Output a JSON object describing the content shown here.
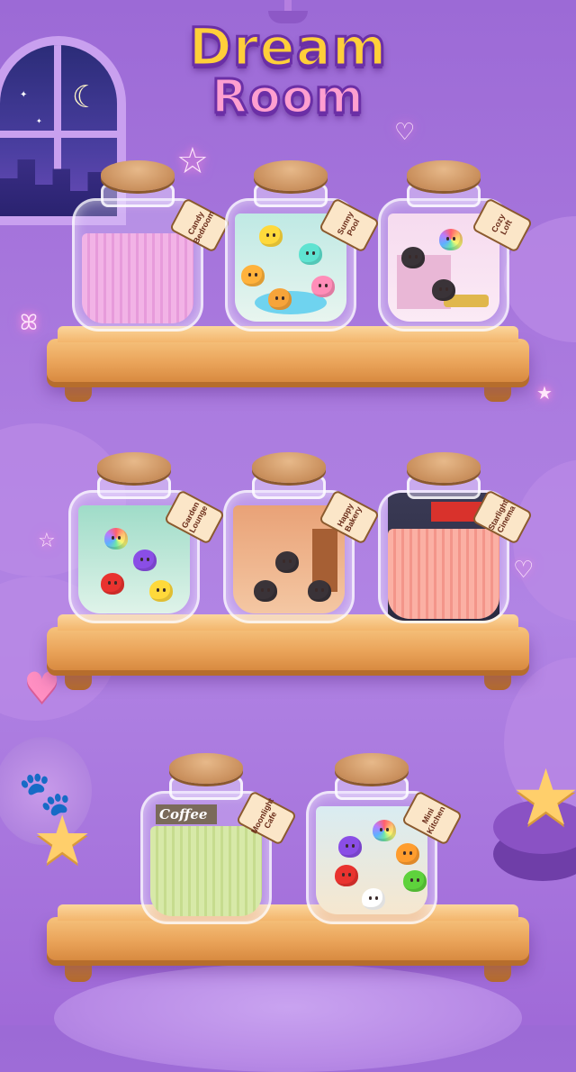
{
  "title": {
    "line1": "Dream",
    "line2": "Room"
  },
  "jars": [
    {
      "id": "candy-bedroom",
      "label": "Candy Bedroom",
      "style": "locked-pink"
    },
    {
      "id": "sunny-pool",
      "label": "Sunny Pool",
      "style": "room-teal"
    },
    {
      "id": "cozy-loft",
      "label": "Cozy Loft",
      "style": "room-pink"
    },
    {
      "id": "garden-lounge",
      "label": "Garden Lounge",
      "style": "room-mint"
    },
    {
      "id": "happy-bakery",
      "label": "Happy Bakery",
      "style": "room-brown"
    },
    {
      "id": "starlight-cinema",
      "label": "Starlight Cinema",
      "style": "locked-salmon"
    },
    {
      "id": "moonlight-cafe",
      "label": "Moonlight Cafe",
      "sign": "Coffee",
      "style": "locked-green"
    },
    {
      "id": "mini-kitchen",
      "label": "Mini Kitchen",
      "style": "room-beige"
    }
  ],
  "icons": [
    "moon-icon",
    "star-icon",
    "heart-icon",
    "paw-icon",
    "butterfly-icon"
  ],
  "colors": {
    "title_yellow": "#ffcf3a",
    "title_pink": "#ff9fd0",
    "outline": "#6b2fa6",
    "shelf": "#eaa45a"
  }
}
